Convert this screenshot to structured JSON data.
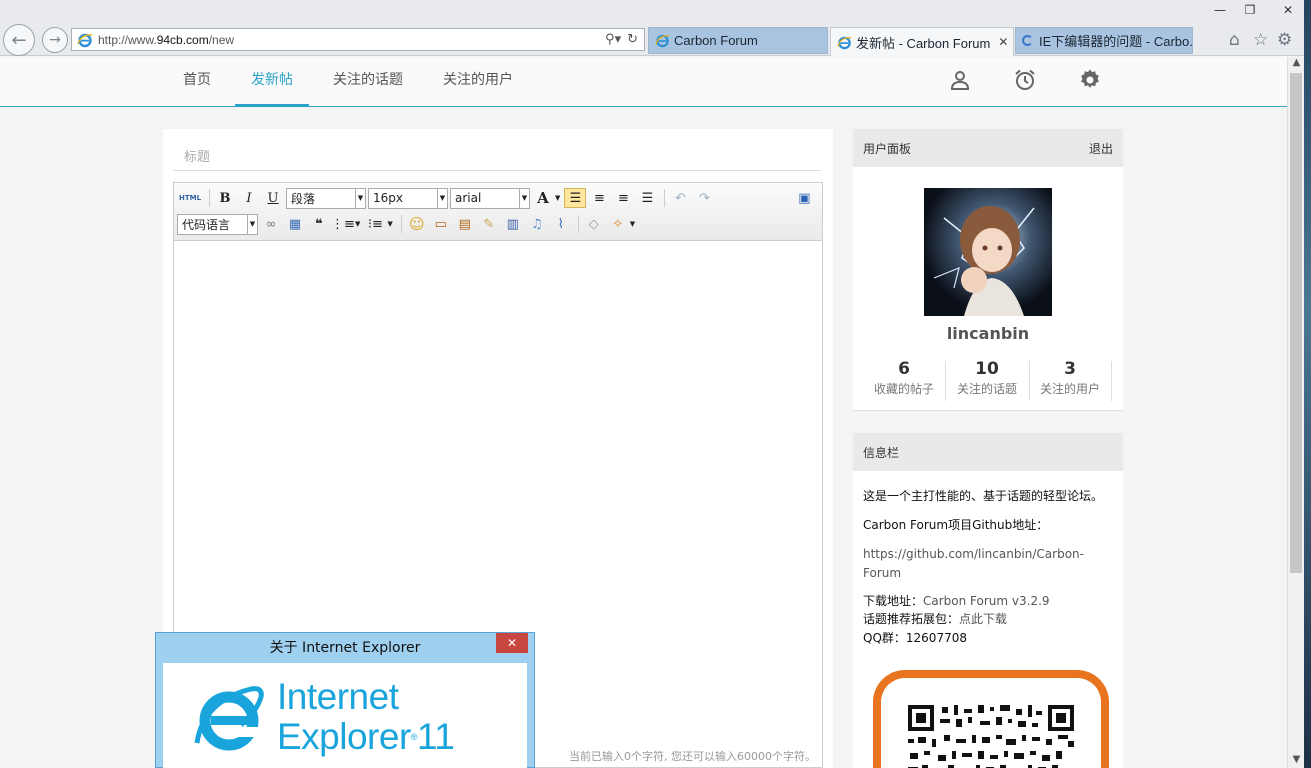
{
  "browser": {
    "address_prefix": "http://www.",
    "address_domain": "94cb.com",
    "address_path": "/new",
    "tabs": [
      {
        "label": "Carbon Forum"
      },
      {
        "label": "发新帖 - Carbon Forum",
        "active": true
      },
      {
        "label": "IE下编辑器的问题 - Carbo..."
      }
    ],
    "window_controls": {
      "minimize": "—",
      "restore": "❐",
      "close": "✕"
    }
  },
  "nav": {
    "items": [
      {
        "label": "首页"
      },
      {
        "label": "发新帖",
        "active": true
      },
      {
        "label": "关注的话题"
      },
      {
        "label": "关注的用户"
      }
    ],
    "icons": [
      "user-icon",
      "alarm-icon",
      "settings-icon"
    ]
  },
  "editor": {
    "title_placeholder": "标题",
    "toolbar": {
      "html_label": "HTML",
      "bold": "B",
      "italic": "I",
      "underline": "U",
      "paragraph_select": "段落",
      "fontsize_select": "16px",
      "fontfamily_select": "arial",
      "forecolor": "A",
      "code_language_select": "代码语言",
      "quote": "❝"
    },
    "word_count": "当前已输入0个字符, 您还可以输入60000个字符。"
  },
  "user_panel": {
    "header": "用户面板",
    "logout": "退出",
    "username": "lincanbin",
    "stats": [
      {
        "num": "6",
        "label": "收藏的帖子"
      },
      {
        "num": "10",
        "label": "关注的话题"
      },
      {
        "num": "3",
        "label": "关注的用户"
      }
    ]
  },
  "info_panel": {
    "header": "信息栏",
    "desc": "这是一个主打性能的、基于话题的轻型论坛。",
    "github_label": "Carbon Forum项目Github地址：",
    "github_url": "https://github.com/lincanbin/Carbon-Forum",
    "download_label": "下载地址：",
    "download_link": "Carbon Forum v3.2.9",
    "extension_label": "话题推荐拓展包：",
    "extension_link": "点此下载",
    "qq_label": "QQ群：",
    "qq_number": "12607708"
  },
  "about_dialog": {
    "title": "关于 Internet Explorer",
    "close": "✕",
    "product_line1": "Internet",
    "product_line2": "Explorer",
    "version": "11"
  },
  "colors": {
    "accent": "#2aa3c7",
    "ie_blue": "#1aa4dc",
    "qr_orange": "#e8741f"
  }
}
